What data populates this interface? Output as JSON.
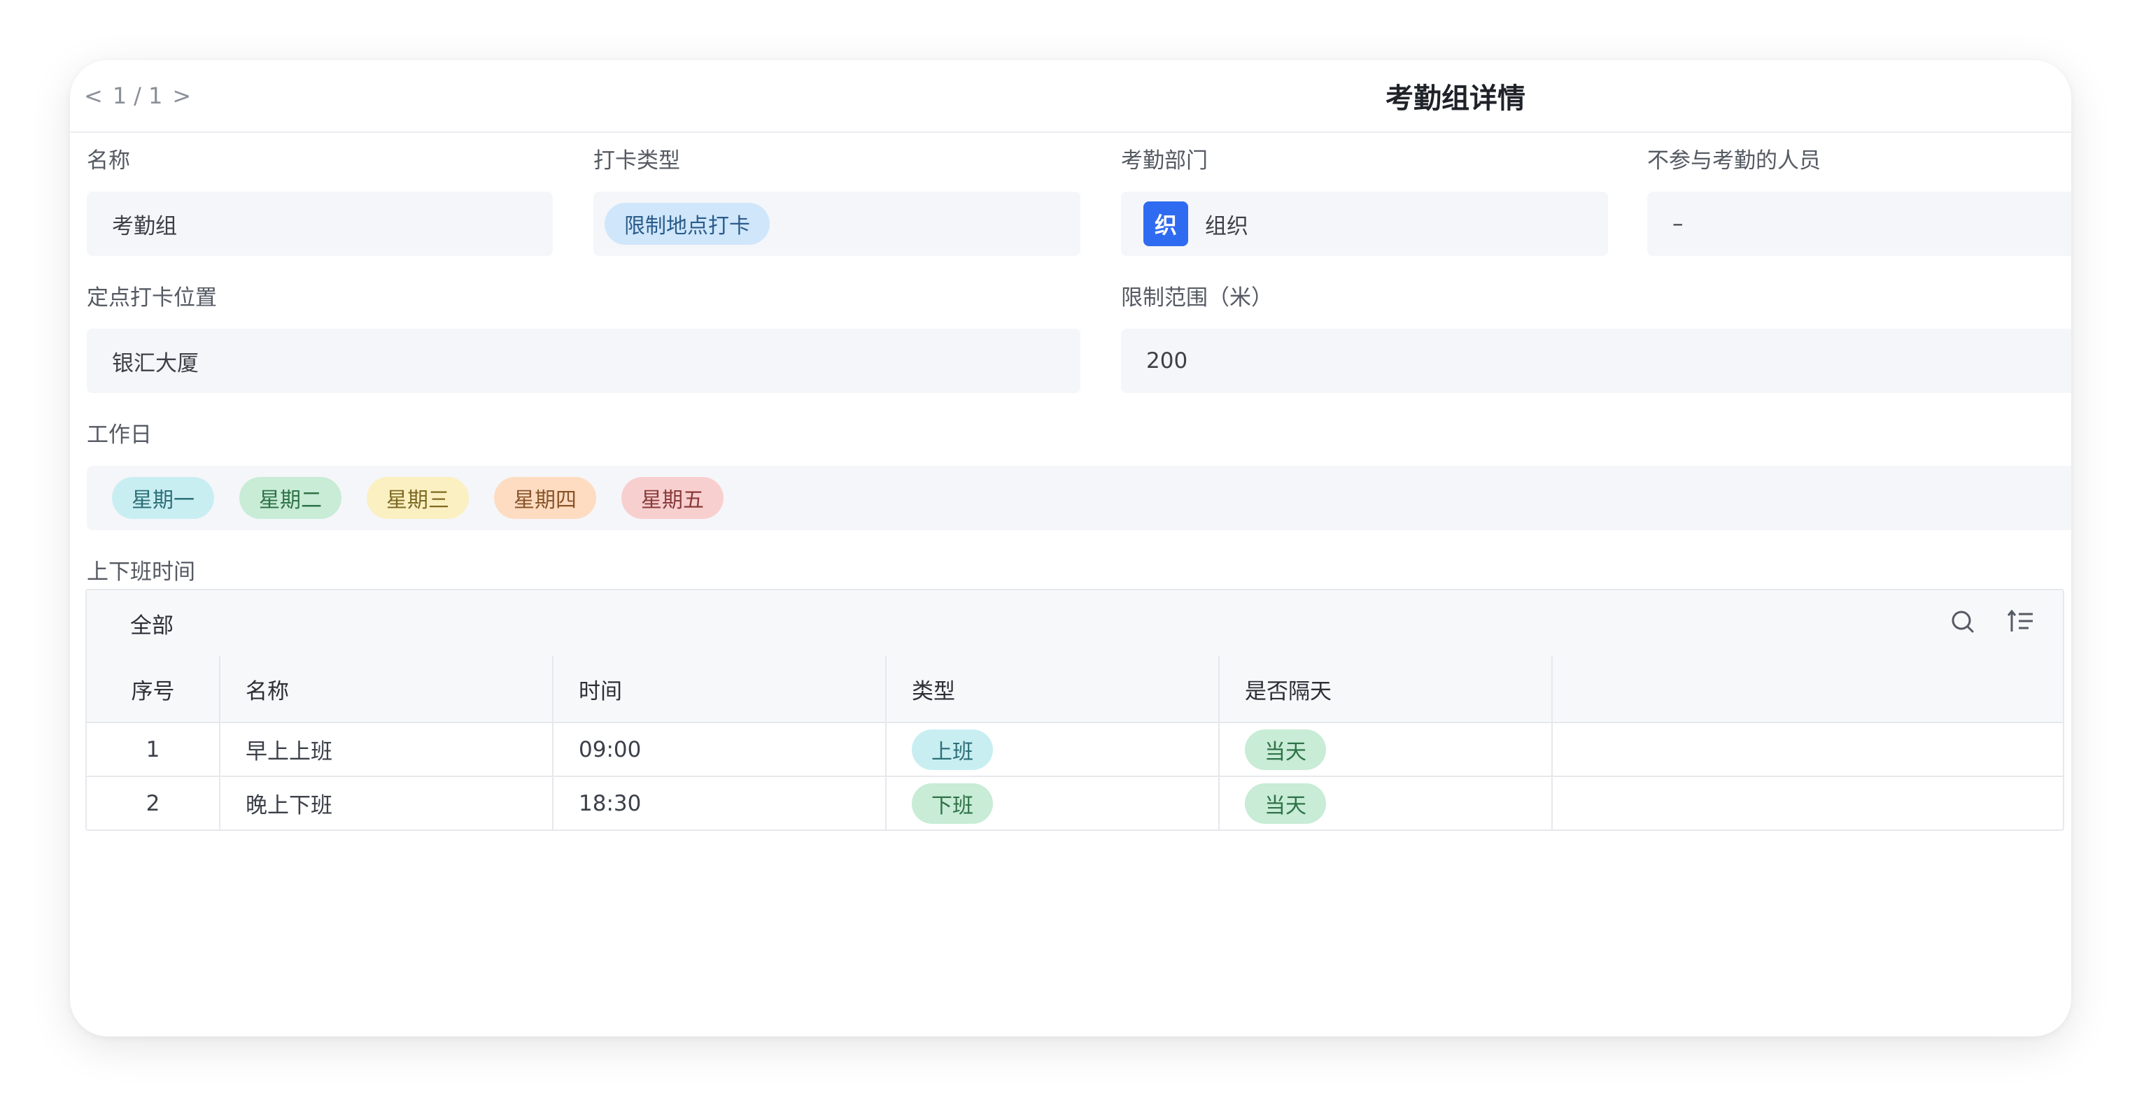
{
  "pager": {
    "prev": "<",
    "current": "1",
    "sep": "/",
    "total": "1",
    "next": ">"
  },
  "title": "考勤组详情",
  "fields": {
    "name_label": "名称",
    "name_value": "考勤组",
    "punch_type_label": "打卡类型",
    "punch_type_value": "限制地点打卡",
    "dept_label": "考勤部门",
    "dept_icon_char": "织",
    "dept_value": "组织",
    "excluded_label": "不参与考勤的人员",
    "excluded_value": "–",
    "location_label": "定点打卡位置",
    "location_value": "银汇大厦",
    "range_label": "限制范围（米）",
    "range_value": "200",
    "workdays_label": "工作日",
    "workdays": [
      {
        "label": "星期一",
        "bg": "#c9eef2",
        "fg": "#2c6f78"
      },
      {
        "label": "星期二",
        "bg": "#c8ecd6",
        "fg": "#2f7248"
      },
      {
        "label": "星期三",
        "bg": "#fbf0c2",
        "fg": "#7d6a22"
      },
      {
        "label": "星期四",
        "bg": "#fddcc2",
        "fg": "#8a5429"
      },
      {
        "label": "星期五",
        "bg": "#f8cfcf",
        "fg": "#8a3a3a"
      }
    ],
    "shift_label": "上下班时间"
  },
  "table": {
    "view_label": "全部",
    "icons": [
      "search-icon",
      "sort-icon"
    ],
    "columns": [
      "序号",
      "名称",
      "时间",
      "类型",
      "是否隔天",
      ""
    ],
    "rows": [
      {
        "index": "1",
        "name": "早上上班",
        "time": "09:00",
        "type": "上班",
        "nextday": "当天"
      },
      {
        "index": "2",
        "name": "晚上下班",
        "time": "18:30",
        "type": "下班",
        "nextday": "当天"
      }
    ]
  },
  "colors": {
    "punch_tag_bg": "#cfe6fb",
    "punch_tag_fg": "#2b5c8a",
    "dept_icon_bg": "#2f6bf0",
    "type_on_bg": "#c9eef2",
    "type_on_fg": "#2c6f78",
    "type_off_bg": "#c8ecd6",
    "type_off_fg": "#2f7248",
    "nextday_bg": "#c8ecd6",
    "nextday_fg": "#2f7248"
  }
}
